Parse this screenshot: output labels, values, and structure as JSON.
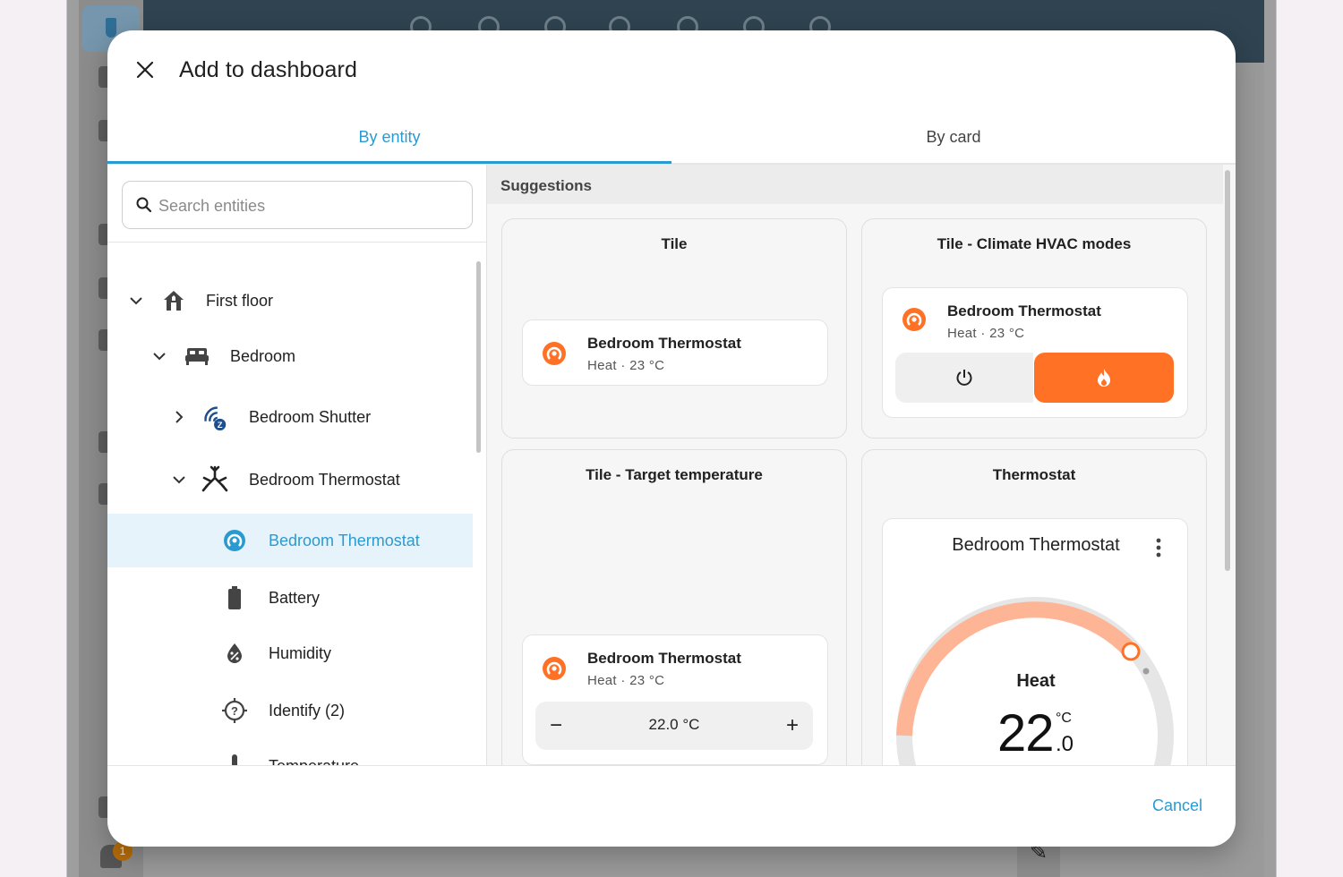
{
  "background": {
    "notification_badge": "1"
  },
  "dialog": {
    "title": "Add to dashboard",
    "tabs": [
      {
        "label": "By entity",
        "active": true
      },
      {
        "label": "By card",
        "active": false
      }
    ],
    "cancel_label": "Cancel"
  },
  "search": {
    "placeholder": "Search entities",
    "value": ""
  },
  "tree": {
    "floor": {
      "label": "First floor",
      "icon": "home-floor-icon",
      "expanded": true
    },
    "area": {
      "label": "Bedroom",
      "icon": "bed-icon",
      "expanded": true
    },
    "devices": [
      {
        "label": "Bedroom Shutter",
        "icon": "zwave-icon",
        "expanded": false
      },
      {
        "label": "Bedroom Thermostat",
        "icon": "snowflake-sun-icon",
        "expanded": true
      }
    ],
    "entities": [
      {
        "label": "Bedroom Thermostat",
        "icon": "thermostat-icon",
        "selected": true
      },
      {
        "label": "Battery",
        "icon": "battery-icon",
        "selected": false
      },
      {
        "label": "Humidity",
        "icon": "water-percent-icon",
        "selected": false
      },
      {
        "label": "Identify (2)",
        "icon": "crosshairs-question-icon",
        "selected": false
      },
      {
        "label": "Temperature",
        "icon": "thermometer-icon",
        "selected": false
      }
    ]
  },
  "suggestions": {
    "header": "Suggestions",
    "cards": [
      {
        "title": "Tile",
        "entity_name": "Bedroom Thermostat",
        "state": "Heat · 23 °C"
      },
      {
        "title": "Tile - Climate HVAC modes",
        "entity_name": "Bedroom Thermostat",
        "state": "Heat · 23 °C",
        "active_mode": "heat"
      },
      {
        "title": "Tile - Target temperature",
        "entity_name": "Bedroom Thermostat",
        "state": "Heat · 23 °C",
        "target": "22.0 °C",
        "minus": "−",
        "plus": "+"
      },
      {
        "title": "Thermostat",
        "entity_name": "Bedroom Thermostat",
        "mode": "Heat",
        "temp_whole": "22",
        "temp_unit": "°C",
        "temp_decimal": ".0"
      }
    ]
  },
  "colors": {
    "accent": "#2b9ad1",
    "heat": "#ff7125",
    "heat_arc": "#fdb595"
  }
}
